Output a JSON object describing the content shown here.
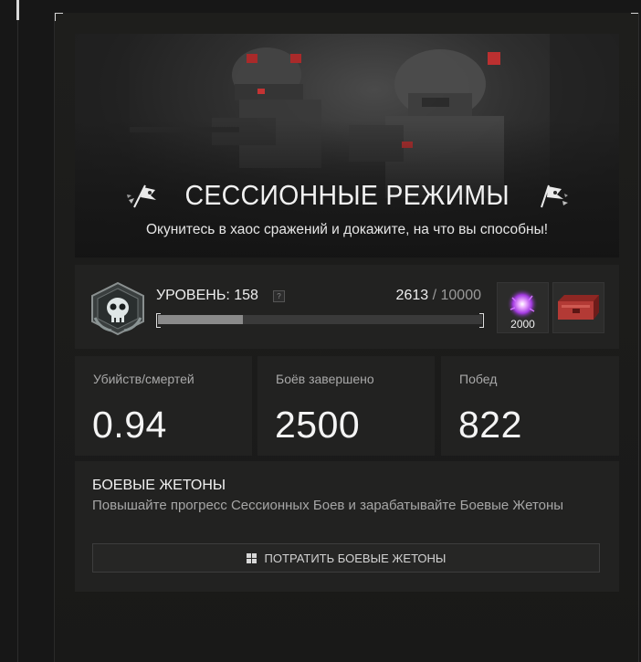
{
  "hero": {
    "title": "СЕССИОННЫЕ РЕЖИМЫ",
    "subtitle": "Окунитесь в хаос сражений и докажите, на что вы способны!",
    "left_icon": "battle-flag-icon",
    "right_icon": "battle-flag-icon"
  },
  "level": {
    "label": "УРОВЕНЬ: 158",
    "help_glyph": "?",
    "xp_current": "2613",
    "xp_separator": "/",
    "xp_max": "10000",
    "progress_fraction": 0.2613,
    "badge_icon": "skull-rank-badge-icon"
  },
  "rewards": [
    {
      "icon": "purple-orb-token-icon",
      "count": "2000"
    },
    {
      "icon": "red-crate-icon",
      "count": ""
    }
  ],
  "stats": [
    {
      "label": "Убийств/смертей",
      "value": "0.94"
    },
    {
      "label": "Боёв завершено",
      "value": "2500"
    },
    {
      "label": "Побед",
      "value": "822"
    }
  ],
  "tokens": {
    "title": "БОЕВЫЕ ЖЕТОНЫ",
    "description": "Повышайте прогресс Сессионных Боев и зарабатывайте Боевые Жетоны",
    "button_label": "ПОТРАТИТЬ БОЕВЫЕ ЖЕТОНЫ",
    "button_icon": "grid-icon"
  },
  "colors": {
    "background": "#171717",
    "panel": "#222221",
    "text": "#f0f0f0",
    "muted": "#a9a9a9",
    "token_purple": "#c04bff",
    "crate_red": "#b33a35"
  }
}
